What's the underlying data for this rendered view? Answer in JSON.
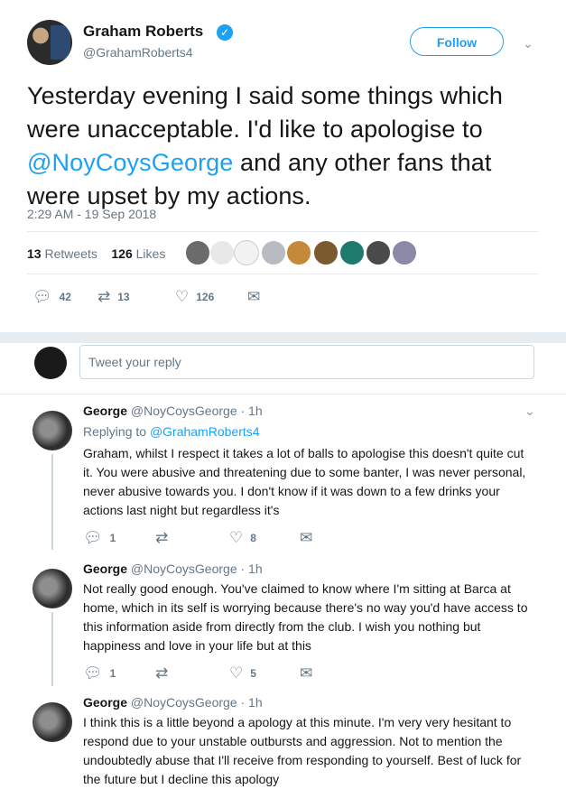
{
  "tweet": {
    "author_name": "Graham Roberts",
    "author_handle": "@GrahamRoberts4",
    "follow_label": "Follow",
    "text_before": "Yesterday evening I said some things which were unacceptable. I'd like to apologise to ",
    "mention": "@NoyCoysGeorge",
    "text_after": " and any other fans that were upset by my actions.",
    "timestamp": "2:29 AM - 19 Sep 2018",
    "retweets_count": "13",
    "retweets_label": "Retweets",
    "likes_count": "126",
    "likes_label": "Likes",
    "reply_count": "42",
    "retweet_count": "13",
    "like_count": "126"
  },
  "reply_box": {
    "placeholder": "Tweet your reply"
  },
  "replies": [
    {
      "name": "George",
      "handle": "@NoyCoysGeorge",
      "time": "· 1h",
      "replying_to_label": "Replying to",
      "replying_to_handle": "@GrahamRoberts4",
      "text": "Graham, whilst I respect it takes a lot of balls to apologise this doesn't quite cut it.  You were abusive and threatening due to some banter, I was never personal, never abusive towards you.  I don't know if it was down to a few drinks your actions last night but regardless it's",
      "reply_count": "1",
      "retweet_count": "",
      "like_count": "8"
    },
    {
      "name": "George",
      "handle": "@NoyCoysGeorge",
      "time": "· 1h",
      "text": "Not really good enough.  You've claimed to know where I'm sitting at Barca at home, which in its self is worrying because there's no way you'd have access to this information aside from directly from the club.  I wish you nothing but happiness and love in your life but at this",
      "reply_count": "1",
      "retweet_count": "",
      "like_count": "5"
    },
    {
      "name": "George",
      "handle": "@NoyCoysGeorge",
      "time": "· 1h",
      "text": "I think this is a little beyond a apology at this minute.  I'm very very hesitant to respond due to your unstable outbursts and aggression.  Not to mention the undoubtedly abuse that I'll receive from responding to yourself.  Best of luck for the future but I decline this apology"
    }
  ],
  "colors": {
    "accent": "#1da1f2",
    "secondary_text": "#657786",
    "divider": "#e6ecf0"
  }
}
